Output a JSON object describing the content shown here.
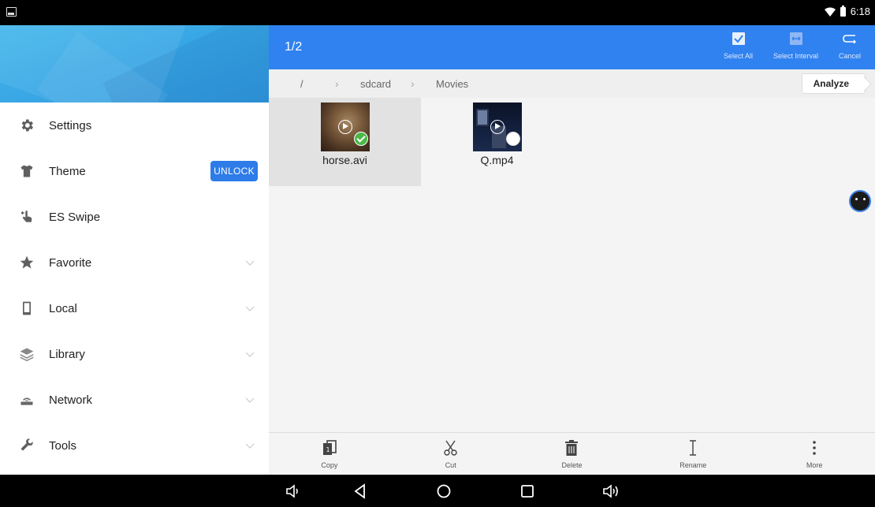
{
  "status_bar": {
    "time": "6:18"
  },
  "sidebar": {
    "items": [
      {
        "label": "Settings",
        "icon": "gear-icon"
      },
      {
        "label": "Theme",
        "icon": "shirt-icon",
        "badge": "UNLOCK"
      },
      {
        "label": "ES Swipe",
        "icon": "swipe-icon"
      },
      {
        "label": "Favorite",
        "icon": "star-icon"
      },
      {
        "label": "Local",
        "icon": "phone-icon"
      },
      {
        "label": "Library",
        "icon": "layers-icon"
      },
      {
        "label": "Network",
        "icon": "router-icon"
      },
      {
        "label": "Tools",
        "icon": "wrench-icon"
      }
    ]
  },
  "action_bar": {
    "selection_count": "1/2",
    "select_all": "Select All",
    "select_interval": "Select Interval",
    "cancel": "Cancel"
  },
  "path": {
    "root": "/",
    "crumbs": [
      "sdcard",
      "Movies"
    ],
    "analyze": "Analyze"
  },
  "files": [
    {
      "name": "horse.avi",
      "selected": true
    },
    {
      "name": "Q.mp4",
      "selected": false
    }
  ],
  "toolbar": {
    "copy": "Copy",
    "cut": "Cut",
    "delete": "Delete",
    "rename": "Rename",
    "more": "More"
  },
  "colors": {
    "accent": "#2f82f0",
    "unlock": "#2d7ce8",
    "selected_check": "#4cb848"
  }
}
